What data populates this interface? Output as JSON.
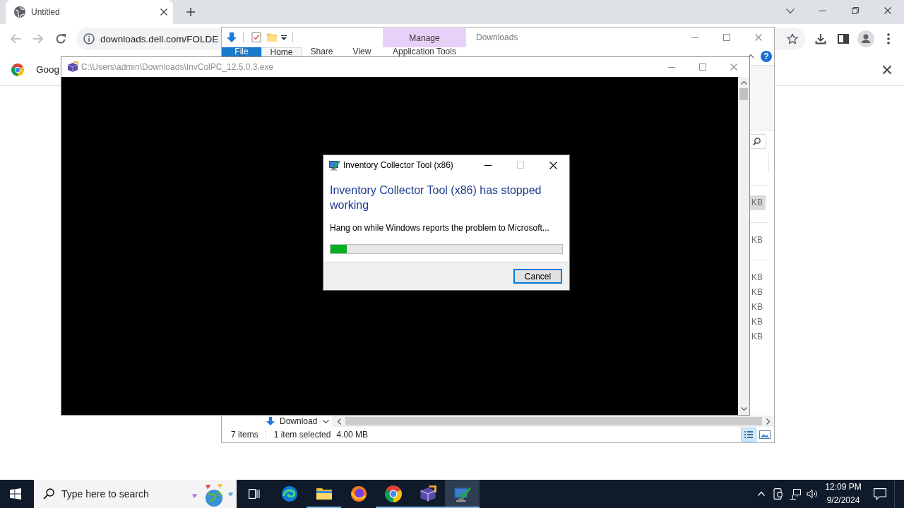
{
  "browser": {
    "tabs": [
      {
        "title": "Untitled",
        "selected": true
      }
    ],
    "back_disabled": true,
    "forward_disabled": true,
    "address_bar": {
      "url": "downloads.dell.com/FOLDE"
    },
    "infobar": {
      "text": "Goog"
    }
  },
  "explorer": {
    "title": "Downloads",
    "context_group": "Manage",
    "ribbon_tabs": [
      {
        "label": "File",
        "kind": "file",
        "selected": false
      },
      {
        "label": "Home",
        "kind": "tab",
        "selected": true
      },
      {
        "label": "Share",
        "kind": "tab",
        "selected": false
      },
      {
        "label": "View",
        "kind": "tab",
        "selected": false
      },
      {
        "label": "Application Tools",
        "kind": "contextual",
        "selected": false
      }
    ],
    "help": "?",
    "file_groups": [
      {
        "files": [
          {
            "size": "KB",
            "selected": true
          }
        ]
      },
      {
        "files": [
          {
            "size": "KB",
            "selected": false
          }
        ]
      },
      {
        "files": [
          {
            "size": "KB",
            "selected": false
          },
          {
            "size": "KB",
            "selected": false
          },
          {
            "size": "KB",
            "selected": false
          },
          {
            "size": "KB",
            "selected": false
          },
          {
            "size": "KB",
            "selected": false
          }
        ]
      }
    ],
    "nav_item": "Download",
    "status": {
      "item_count": "7 items",
      "selection": "1 item selected",
      "selection_size": "4.00 MB"
    },
    "views": [
      {
        "kind": "details",
        "selected": true
      },
      {
        "kind": "large_icons",
        "selected": false
      }
    ]
  },
  "console": {
    "title": "C:\\Users\\admin\\Downloads\\InvColPC_12.5.0.3.exe"
  },
  "dialog": {
    "title": "Inventory Collector Tool (x86)",
    "maximize_disabled": true,
    "heading": "Inventory Collector Tool (x86) has stopped working",
    "message": "Hang on while Windows reports the problem to Microsoft...",
    "progress": {
      "level": 0.07
    },
    "buttons": [
      {
        "label": "Cancel",
        "focused": true
      }
    ]
  },
  "taskbar": {
    "search": {
      "placeholder": "Type here to search"
    },
    "apps": [
      {
        "kind": "edge",
        "running": false,
        "active": false
      },
      {
        "kind": "explorer",
        "running": true,
        "active": false
      },
      {
        "kind": "firefox",
        "running": false,
        "active": false
      },
      {
        "kind": "chrome",
        "running": true,
        "active": false
      },
      {
        "kind": "installer",
        "running": true,
        "active": false
      },
      {
        "kind": "app",
        "running": true,
        "active": true
      }
    ],
    "clock": {
      "time": "12:09 PM",
      "date": "9/2/2024"
    }
  }
}
